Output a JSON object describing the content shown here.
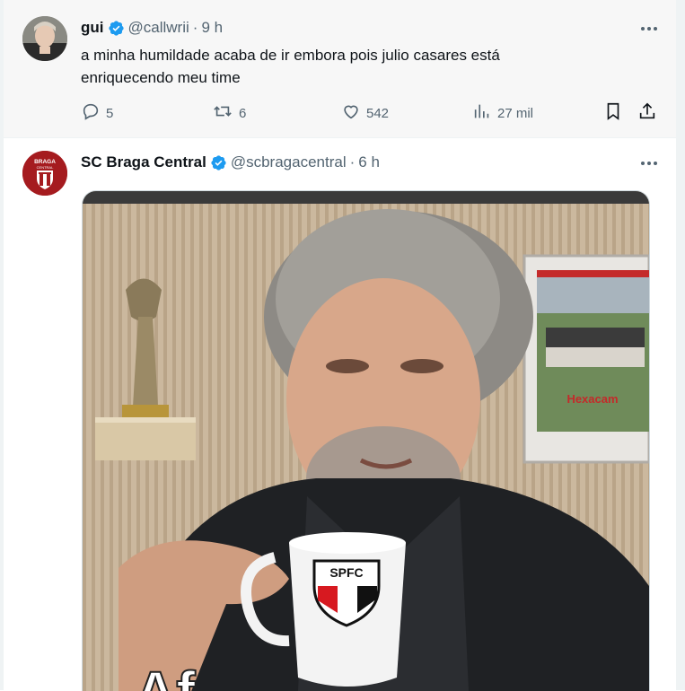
{
  "tweet1": {
    "name": "gui",
    "handle": "@callwrii",
    "separator": "·",
    "time": "9 h",
    "text_line1": "a minha humildade acaba de ir embora pois julio casares está",
    "text_line2": "enriquecendo meu time",
    "replies": "5",
    "retweets": "6",
    "likes": "542",
    "views": "27 mil"
  },
  "tweet2": {
    "name": "SC Braga Central",
    "handle": "@scbragacentral",
    "separator": "·",
    "time": "6 h",
    "avatar_text_top": "BRAGA",
    "avatar_text_sub": "CENTRAL",
    "media": {
      "cup_text": "SPFC",
      "frame_caption": "Hexacam",
      "overlay_text": "Af"
    }
  },
  "colors": {
    "verified": "#1d9bf0",
    "secondary_text": "#536471",
    "primary_text": "#0f1419",
    "braga_red": "#a51b1f",
    "spfc_red": "#d71920"
  },
  "icons": [
    "more-icon",
    "verified-icon",
    "reply-icon",
    "retweet-icon",
    "like-icon",
    "views-icon",
    "bookmark-icon",
    "share-icon"
  ]
}
